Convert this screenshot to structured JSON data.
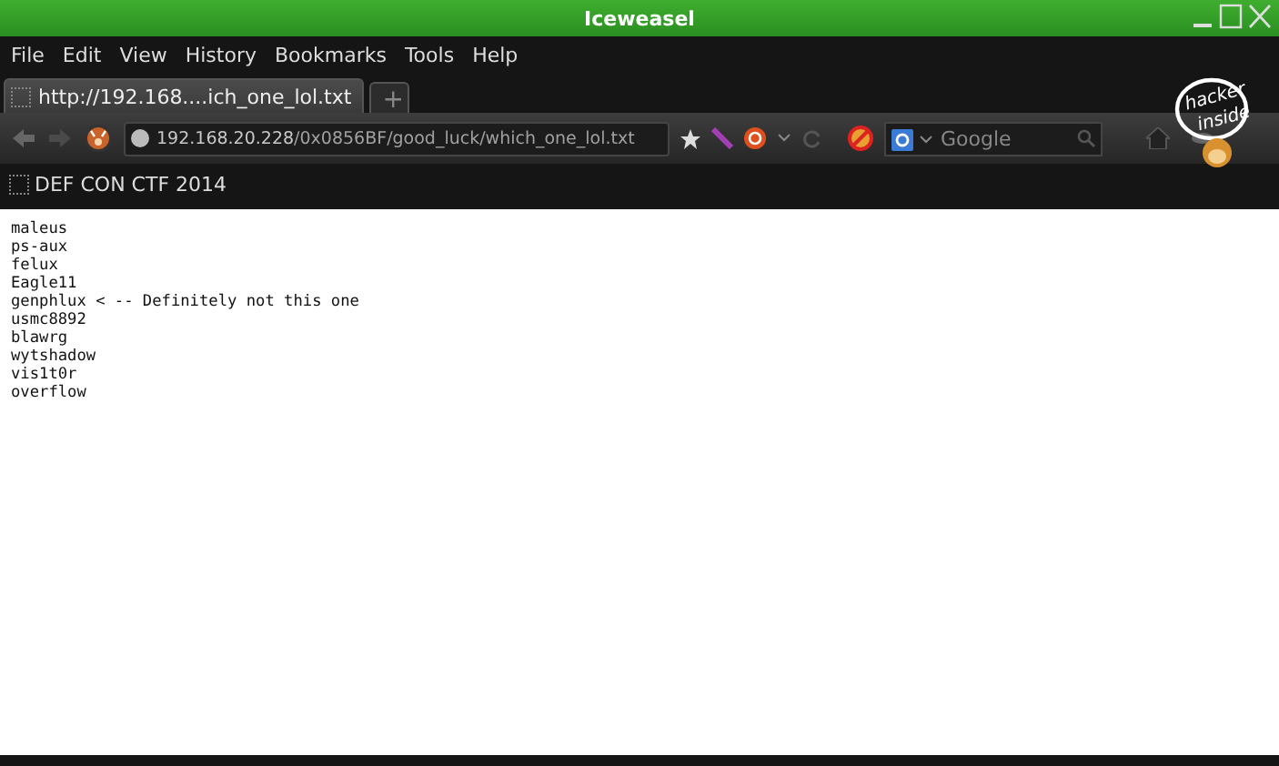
{
  "window": {
    "title": "Iceweasel"
  },
  "menu": [
    {
      "label": "File"
    },
    {
      "label": "Edit"
    },
    {
      "label": "View"
    },
    {
      "label": "History"
    },
    {
      "label": "Bookmarks"
    },
    {
      "label": "Tools"
    },
    {
      "label": "Help"
    }
  ],
  "tabs": [
    {
      "label": "http://192.168....ich_one_lol.txt",
      "selected": true
    }
  ],
  "new_tab": "+",
  "address": {
    "host": "192.168.20.228",
    "path": "/0x0856BF/good_luck/which_one_lol.txt"
  },
  "search": {
    "placeholder": "Google"
  },
  "logo": {
    "line_1": "hacker",
    "line_2": "inside"
  },
  "bookmarks": [
    {
      "label": "DEF CON CTF 2014"
    }
  ],
  "content": {
    "lines": [
      "maleus",
      "ps-aux",
      "felux",
      "Eagle11",
      "genphlux < -- Definitely not this one",
      "usmc8892",
      "blawrg",
      "wytshadow",
      "vis1t0r",
      "overflow"
    ]
  }
}
